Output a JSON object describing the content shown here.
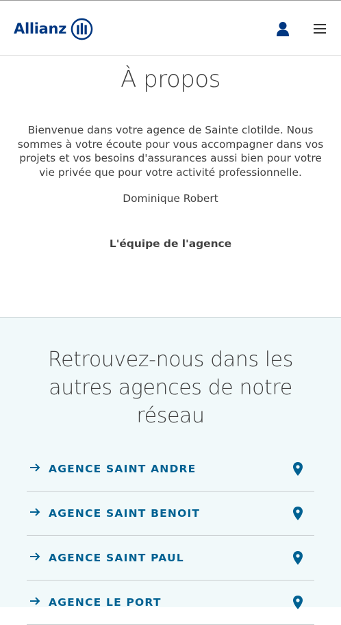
{
  "header": {
    "logo_text": "Allianz",
    "logo_icon": "allianz-eagle-logo",
    "user_icon": "user-icon",
    "menu_icon": "hamburger-menu-icon"
  },
  "about": {
    "title": "À propos",
    "intro": "Bienvenue dans votre agence de Sainte clotilde. Nous sommes à votre écoute pour vous accompagner dans vos projets et vos besoins d'assurances aussi bien pour votre vie privée que pour votre activité professionnelle.",
    "signature": "Dominique Robert",
    "team": "L'équipe de l'agence"
  },
  "network": {
    "title": "Retrouvez-nous dans les autres agences de notre réseau",
    "agencies": [
      {
        "label": "AGENCE SAINT ANDRE"
      },
      {
        "label": "AGENCE SAINT BENOIT"
      },
      {
        "label": "AGENCE SAINT PAUL"
      },
      {
        "label": "AGENCE LE PORT"
      }
    ]
  },
  "colors": {
    "brand_blue": "#003781",
    "link_blue": "#006192",
    "section_bg": "#f1f9fa"
  }
}
